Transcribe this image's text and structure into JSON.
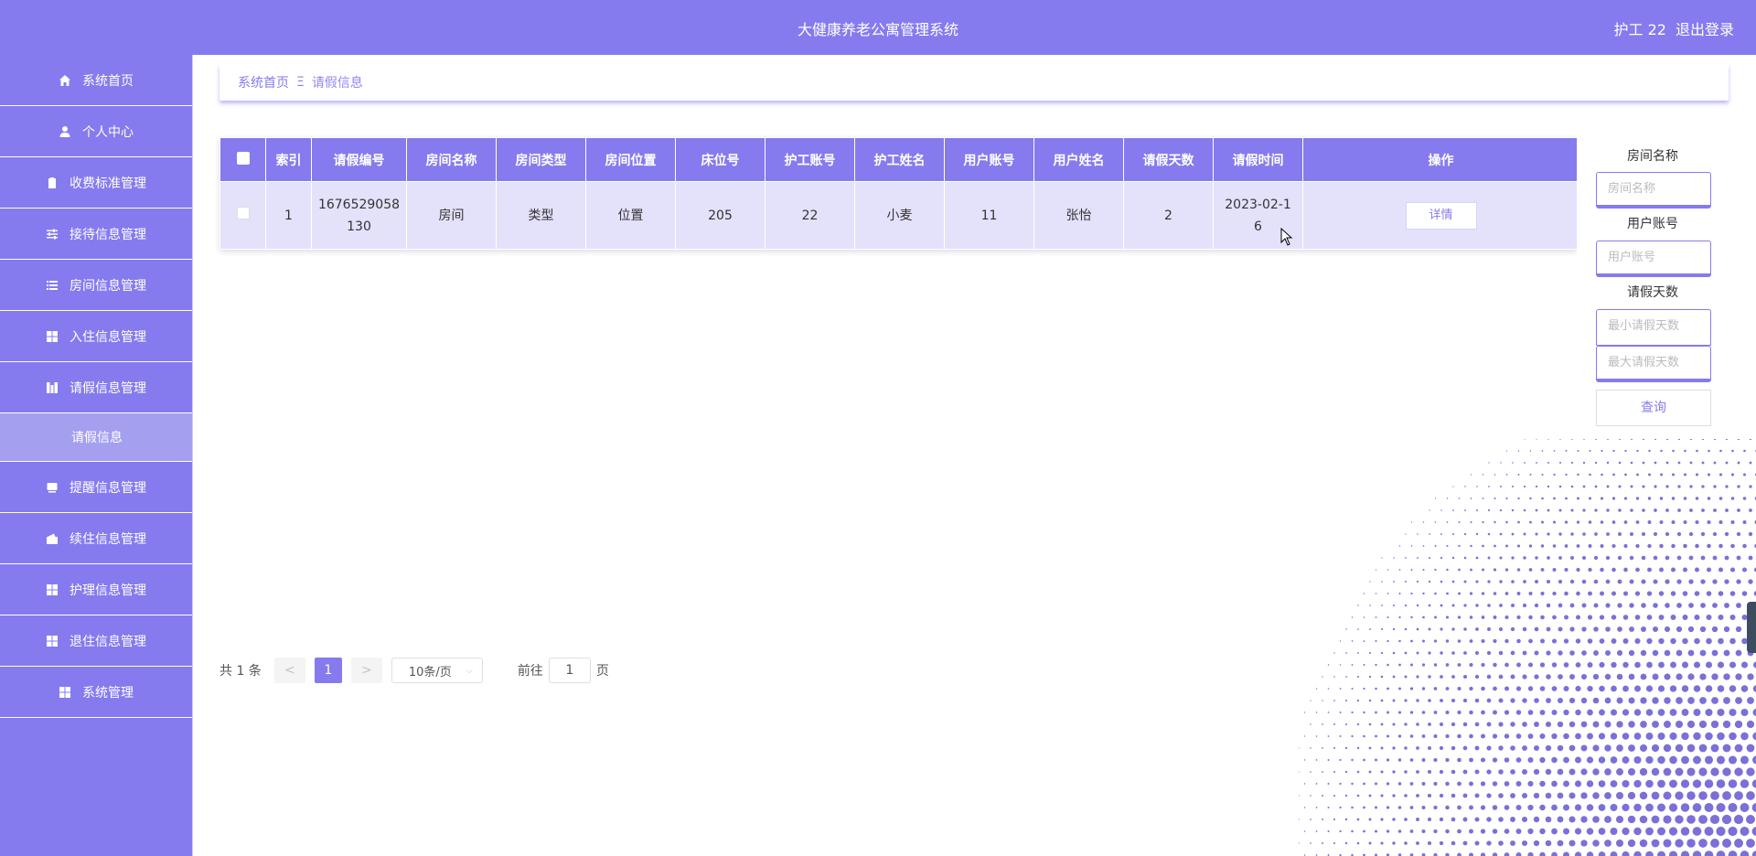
{
  "header": {
    "title": "大健康养老公寓管理系统",
    "user": "护工 22",
    "logout": "退出登录"
  },
  "sidebar": {
    "items": [
      {
        "label": "系统首页",
        "icon": "home-icon"
      },
      {
        "label": "个人中心",
        "icon": "user-icon"
      },
      {
        "label": "收费标准管理",
        "icon": "clipboard-icon"
      },
      {
        "label": "接待信息管理",
        "icon": "sliders-icon"
      },
      {
        "label": "房间信息管理",
        "icon": "list-icon"
      },
      {
        "label": "入住信息管理",
        "icon": "grid-icon"
      },
      {
        "label": "请假信息管理",
        "icon": "chart-icon"
      },
      {
        "label": "请假信息",
        "sub": true
      },
      {
        "label": "提醒信息管理",
        "icon": "monitor-icon"
      },
      {
        "label": "续住信息管理",
        "icon": "wallet-icon"
      },
      {
        "label": "护理信息管理",
        "icon": "grid-icon"
      },
      {
        "label": "退住信息管理",
        "icon": "grid-icon"
      },
      {
        "label": "系统管理",
        "icon": "grid-icon"
      }
    ]
  },
  "breadcrumb": {
    "home": "系统首页",
    "separator": "Ξ",
    "current": "请假信息"
  },
  "table": {
    "headers": [
      "索引",
      "请假编号",
      "房间名称",
      "房间类型",
      "房间位置",
      "床位号",
      "护工账号",
      "护工姓名",
      "用户账号",
      "用户姓名",
      "请假天数",
      "请假时间",
      "操作"
    ],
    "rows": [
      {
        "index": "1",
        "leave_no": "1676529058130",
        "room_name": "房间",
        "room_type": "类型",
        "room_location": "位置",
        "bed_no": "205",
        "nurse_account": "22",
        "nurse_name": "小麦",
        "user_account": "11",
        "user_name": "张怡",
        "leave_days": "2",
        "leave_time": "2023-02-16",
        "action": "详情"
      }
    ]
  },
  "search": {
    "room_name_label": "房间名称",
    "room_name_placeholder": "房间名称",
    "user_account_label": "用户账号",
    "user_account_placeholder": "用户账号",
    "leave_days_label": "请假天数",
    "min_days_placeholder": "最小请假天数",
    "max_days_placeholder": "最大请假天数",
    "query_button": "查询"
  },
  "pagination": {
    "total": "共 1 条",
    "prev": "<",
    "current_page": "1",
    "next": ">",
    "page_size": "10条/页",
    "goto_prefix": "前往",
    "goto_value": "1",
    "goto_suffix": "页"
  },
  "colors": {
    "accent": "#857bee",
    "row_bg": "#e4e1fb",
    "sub_menu_bg": "#a59ff0"
  }
}
